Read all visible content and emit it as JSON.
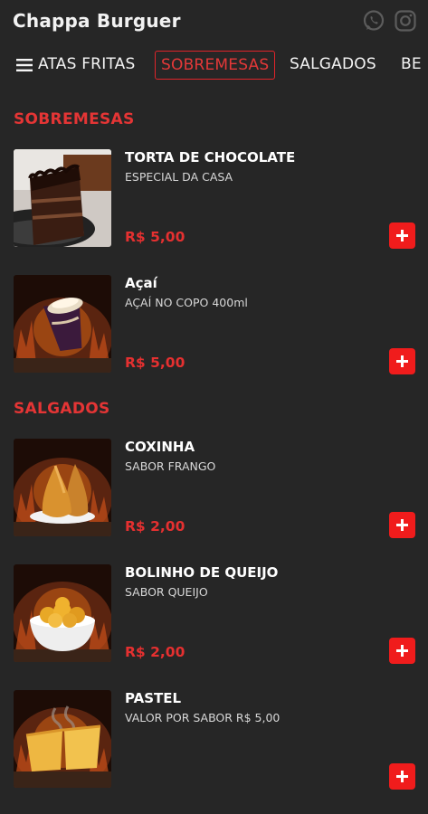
{
  "header": {
    "title": "Chappa Burguer",
    "icons": [
      "whatsapp-icon",
      "instagram-icon"
    ]
  },
  "tabs": [
    {
      "label": "ATAS FRITAS",
      "active": false
    },
    {
      "label": "SOBREMESAS",
      "active": true
    },
    {
      "label": "SALGADOS",
      "active": false
    },
    {
      "label": "BE",
      "active": false
    }
  ],
  "sections": [
    {
      "title": "SOBREMESAS",
      "items": [
        {
          "name": "TORTA DE CHOCOLATE",
          "desc": "ESPECIAL DA CASA",
          "price": "R$ 5,00",
          "image": "chocolate-cake"
        },
        {
          "name": "Açaí",
          "desc": "AÇAÍ NO COPO 400ml",
          "price": "R$ 5,00",
          "image": "acai-cup"
        }
      ]
    },
    {
      "title": "SALGADOS",
      "items": [
        {
          "name": "COXINHA",
          "desc": "SABOR FRANGO",
          "price": "R$ 2,00",
          "image": "coxinha"
        },
        {
          "name": "BOLINHO DE QUEIJO",
          "desc": "SABOR QUEIJO",
          "price": "R$ 2,00",
          "image": "cheese-balls"
        },
        {
          "name": "PASTEL",
          "desc": "VALOR POR SABOR R$ 5,00",
          "price": "",
          "image": "pastel"
        }
      ]
    }
  ],
  "colors": {
    "background": "#262626",
    "accent": "#e43535",
    "add_button": "#f01c1c",
    "text": "#ffffff"
  }
}
